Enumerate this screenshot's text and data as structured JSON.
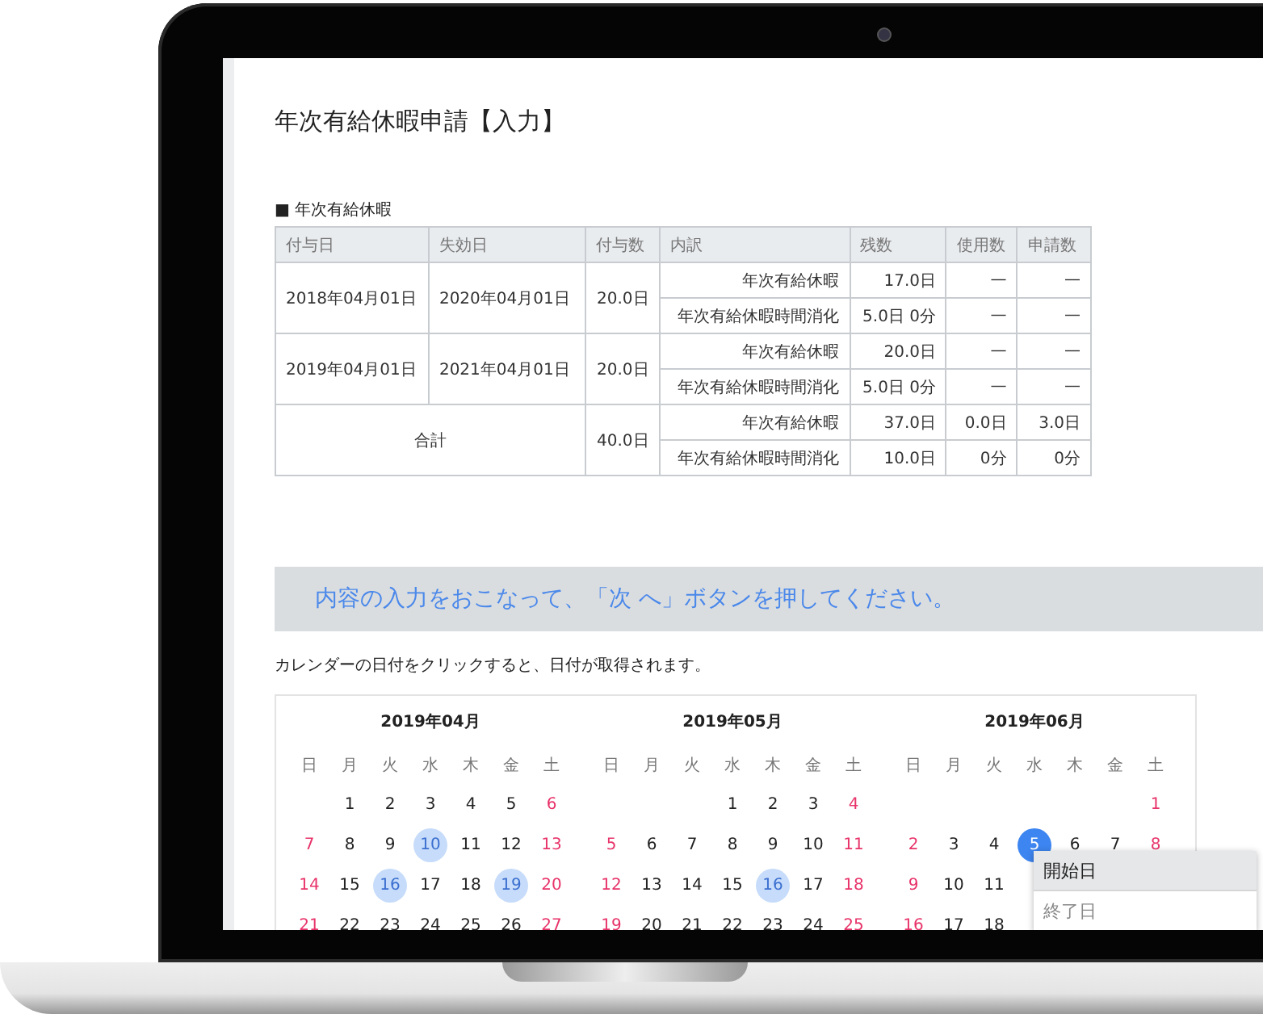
{
  "page": {
    "title": "年次有給休暇申請【入力】",
    "section_label": "■ 年次有給休暇"
  },
  "leave_table": {
    "columns": [
      "付与日",
      "失効日",
      "付与数",
      "内訳",
      "残数",
      "使用数",
      "申請数"
    ],
    "groups": [
      {
        "grant_date": "2018年04月01日",
        "expiry_date": "2020年04月01日",
        "grant_count": "20.0日",
        "breakdown": [
          {
            "type": "年次有給休暇",
            "remaining": "17.0日",
            "used": "—",
            "requested": "—"
          },
          {
            "type": "年次有給休暇時間消化",
            "remaining": "5.0日 0分",
            "used": "—",
            "requested": "—"
          }
        ]
      },
      {
        "grant_date": "2019年04月01日",
        "expiry_date": "2021年04月01日",
        "grant_count": "20.0日",
        "breakdown": [
          {
            "type": "年次有給休暇",
            "remaining": "20.0日",
            "used": "—",
            "requested": "—"
          },
          {
            "type": "年次有給休暇時間消化",
            "remaining": "5.0日 0分",
            "used": "—",
            "requested": "—"
          }
        ]
      }
    ],
    "total": {
      "label": "合計",
      "grant_count": "40.0日",
      "breakdown": [
        {
          "type": "年次有給休暇",
          "remaining": "37.0日",
          "used": "0.0日",
          "requested": "3.0日"
        },
        {
          "type": "年次有給休暇時間消化",
          "remaining": "10.0日",
          "used": "0分",
          "requested": "0分"
        }
      ]
    }
  },
  "notice": "内容の入力をおこなって、「次 へ」ボタンを押してください。",
  "calendar_hint": "カレンダーの日付をクリックすると、日付が取得されます。",
  "calendar": {
    "months": [
      {
        "title": "2019年04月",
        "weekdays": [
          "日",
          "月",
          "火",
          "水",
          "木",
          "金",
          "土"
        ],
        "weeks": [
          [
            {
              "kind": "blank"
            },
            {
              "kind": "day",
              "day": "1",
              "requested": false,
              "selected": false
            },
            {
              "kind": "day",
              "day": "2",
              "requested": false,
              "selected": false
            },
            {
              "kind": "day",
              "day": "3",
              "requested": false,
              "selected": false
            },
            {
              "kind": "day",
              "day": "4",
              "requested": false,
              "selected": false
            },
            {
              "kind": "day",
              "day": "5",
              "requested": false,
              "selected": false
            },
            {
              "kind": "day",
              "day": "6",
              "requested": false,
              "selected": false
            }
          ],
          [
            {
              "kind": "day",
              "day": "7",
              "requested": false,
              "selected": false
            },
            {
              "kind": "day",
              "day": "8",
              "requested": false,
              "selected": false
            },
            {
              "kind": "day",
              "day": "9",
              "requested": false,
              "selected": false
            },
            {
              "kind": "day",
              "day": "10",
              "requested": true,
              "selected": false
            },
            {
              "kind": "day",
              "day": "11",
              "requested": false,
              "selected": false
            },
            {
              "kind": "day",
              "day": "12",
              "requested": false,
              "selected": false
            },
            {
              "kind": "day",
              "day": "13",
              "requested": false,
              "selected": false
            }
          ],
          [
            {
              "kind": "day",
              "day": "14",
              "requested": false,
              "selected": false
            },
            {
              "kind": "day",
              "day": "15",
              "requested": false,
              "selected": false
            },
            {
              "kind": "day",
              "day": "16",
              "requested": true,
              "selected": false
            },
            {
              "kind": "day",
              "day": "17",
              "requested": false,
              "selected": false
            },
            {
              "kind": "day",
              "day": "18",
              "requested": false,
              "selected": false
            },
            {
              "kind": "day",
              "day": "19",
              "requested": true,
              "selected": false
            },
            {
              "kind": "day",
              "day": "20",
              "requested": false,
              "selected": false
            }
          ],
          [
            {
              "kind": "day",
              "day": "21",
              "requested": false,
              "selected": false
            },
            {
              "kind": "day",
              "day": "22",
              "requested": false,
              "selected": false
            },
            {
              "kind": "day",
              "day": "23",
              "requested": false,
              "selected": false
            },
            {
              "kind": "day",
              "day": "24",
              "requested": false,
              "selected": false
            },
            {
              "kind": "day",
              "day": "25",
              "requested": false,
              "selected": false
            },
            {
              "kind": "day",
              "day": "26",
              "requested": false,
              "selected": false
            },
            {
              "kind": "day",
              "day": "27",
              "requested": false,
              "selected": false
            }
          ]
        ]
      },
      {
        "title": "2019年05月",
        "weekdays": [
          "日",
          "月",
          "火",
          "水",
          "木",
          "金",
          "土"
        ],
        "weeks": [
          [
            {
              "kind": "blank"
            },
            {
              "kind": "blank"
            },
            {
              "kind": "blank"
            },
            {
              "kind": "day",
              "day": "1",
              "requested": false,
              "selected": false
            },
            {
              "kind": "day",
              "day": "2",
              "requested": false,
              "selected": false
            },
            {
              "kind": "day",
              "day": "3",
              "requested": false,
              "selected": false
            },
            {
              "kind": "day",
              "day": "4",
              "requested": false,
              "selected": false
            }
          ],
          [
            {
              "kind": "day",
              "day": "5",
              "requested": false,
              "selected": false
            },
            {
              "kind": "day",
              "day": "6",
              "requested": false,
              "selected": false
            },
            {
              "kind": "day",
              "day": "7",
              "requested": false,
              "selected": false
            },
            {
              "kind": "day",
              "day": "8",
              "requested": false,
              "selected": false
            },
            {
              "kind": "day",
              "day": "9",
              "requested": false,
              "selected": false
            },
            {
              "kind": "day",
              "day": "10",
              "requested": false,
              "selected": false
            },
            {
              "kind": "day",
              "day": "11",
              "requested": false,
              "selected": false
            }
          ],
          [
            {
              "kind": "day",
              "day": "12",
              "requested": false,
              "selected": false
            },
            {
              "kind": "day",
              "day": "13",
              "requested": false,
              "selected": false
            },
            {
              "kind": "day",
              "day": "14",
              "requested": false,
              "selected": false
            },
            {
              "kind": "day",
              "day": "15",
              "requested": false,
              "selected": false
            },
            {
              "kind": "day",
              "day": "16",
              "requested": true,
              "selected": false
            },
            {
              "kind": "day",
              "day": "17",
              "requested": false,
              "selected": false
            },
            {
              "kind": "day",
              "day": "18",
              "requested": false,
              "selected": false
            }
          ],
          [
            {
              "kind": "day",
              "day": "19",
              "requested": false,
              "selected": false
            },
            {
              "kind": "day",
              "day": "20",
              "requested": false,
              "selected": false
            },
            {
              "kind": "day",
              "day": "21",
              "requested": false,
              "selected": false
            },
            {
              "kind": "day",
              "day": "22",
              "requested": false,
              "selected": false
            },
            {
              "kind": "day",
              "day": "23",
              "requested": false,
              "selected": false
            },
            {
              "kind": "day",
              "day": "24",
              "requested": false,
              "selected": false
            },
            {
              "kind": "day",
              "day": "25",
              "requested": false,
              "selected": false
            }
          ]
        ]
      },
      {
        "title": "2019年06月",
        "weekdays": [
          "日",
          "月",
          "火",
          "水",
          "木",
          "金",
          "土"
        ],
        "weeks": [
          [
            {
              "kind": "blank"
            },
            {
              "kind": "blank"
            },
            {
              "kind": "blank"
            },
            {
              "kind": "blank"
            },
            {
              "kind": "blank"
            },
            {
              "kind": "blank"
            },
            {
              "kind": "day",
              "day": "1",
              "requested": false,
              "selected": false
            }
          ],
          [
            {
              "kind": "day",
              "day": "2",
              "requested": false,
              "selected": false
            },
            {
              "kind": "day",
              "day": "3",
              "requested": false,
              "selected": false
            },
            {
              "kind": "day",
              "day": "4",
              "requested": false,
              "selected": false
            },
            {
              "kind": "day",
              "day": "5",
              "requested": false,
              "selected": true
            },
            {
              "kind": "day",
              "day": "6",
              "requested": false,
              "selected": false
            },
            {
              "kind": "day",
              "day": "7",
              "requested": false,
              "selected": false
            },
            {
              "kind": "day",
              "day": "8",
              "requested": false,
              "selected": false
            }
          ],
          [
            {
              "kind": "day",
              "day": "9",
              "requested": false,
              "selected": false
            },
            {
              "kind": "day",
              "day": "10",
              "requested": false,
              "selected": false
            },
            {
              "kind": "day",
              "day": "11",
              "requested": false,
              "selected": false
            }
          ],
          [
            {
              "kind": "day",
              "day": "16",
              "requested": false,
              "selected": false
            },
            {
              "kind": "day",
              "day": "17",
              "requested": false,
              "selected": false
            },
            {
              "kind": "day",
              "day": "18",
              "requested": false,
              "selected": false
            }
          ]
        ]
      }
    ]
  },
  "date_menu": {
    "items": [
      {
        "label": "開始日",
        "selected": true
      },
      {
        "label": "終了日",
        "selected": false
      }
    ]
  }
}
